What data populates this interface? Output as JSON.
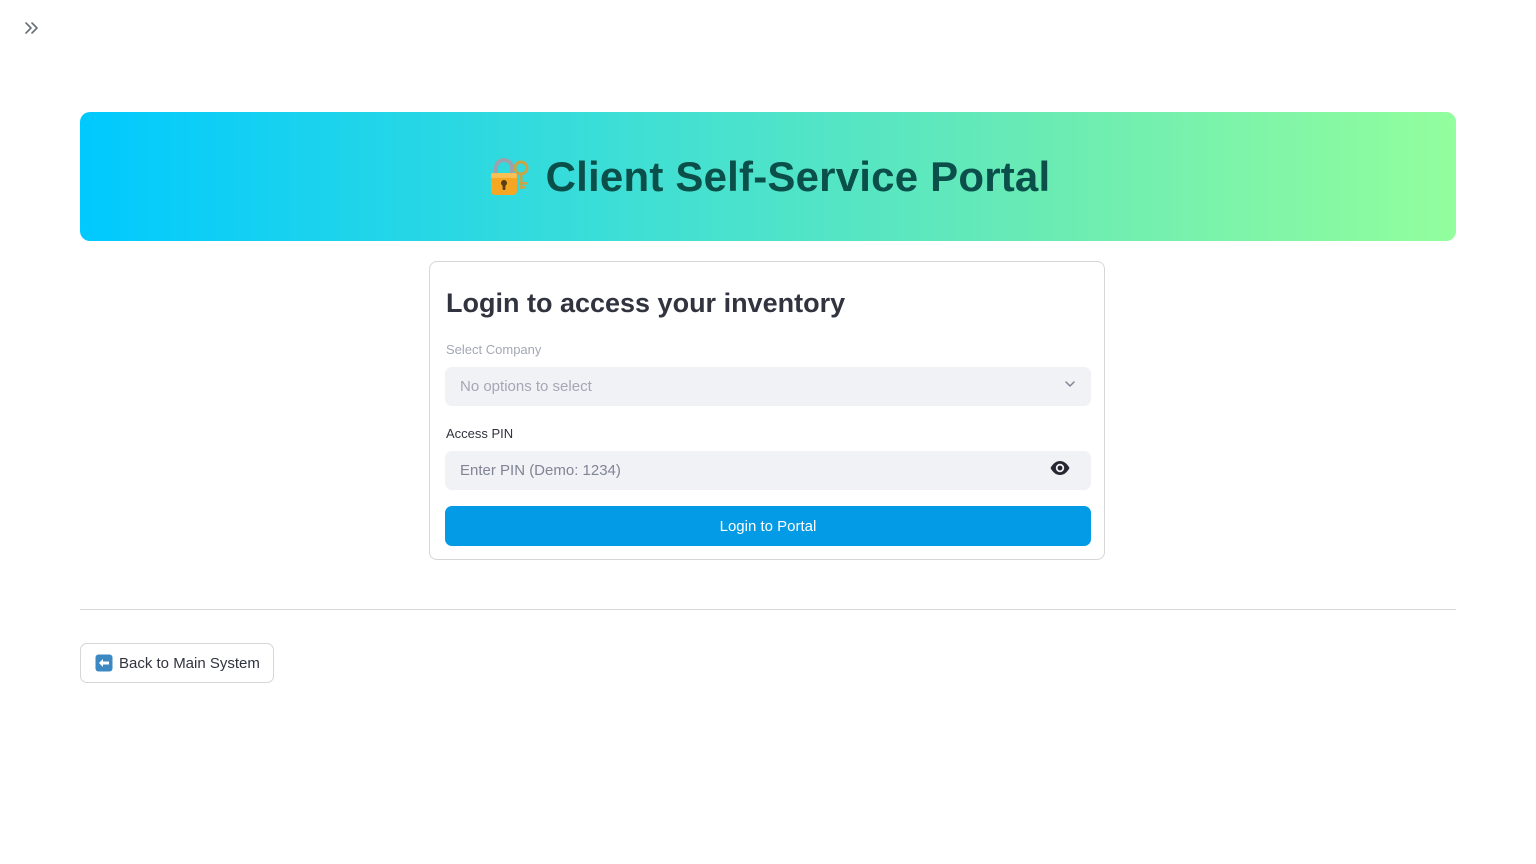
{
  "header": {
    "title": "Client Self-Service Portal",
    "icon": "locked-with-key-icon"
  },
  "sidebar": {
    "toggle_icon": "double-chevron-right-icon"
  },
  "login": {
    "heading": "Login to access your inventory",
    "company_label": "Select Company",
    "company_placeholder": "No options to select",
    "pin_label": "Access PIN",
    "pin_placeholder": "Enter PIN (Demo: 1234)",
    "pin_value": "",
    "submit_label": "Login to Portal"
  },
  "footer": {
    "back_label": "Back to Main System",
    "back_icon": "left-arrow-icon"
  },
  "colors": {
    "banner_gradient_start": "#00c9ff",
    "banner_gradient_end": "#92fe9d",
    "title_color": "#0b4f4a",
    "primary_button": "#039be5"
  }
}
